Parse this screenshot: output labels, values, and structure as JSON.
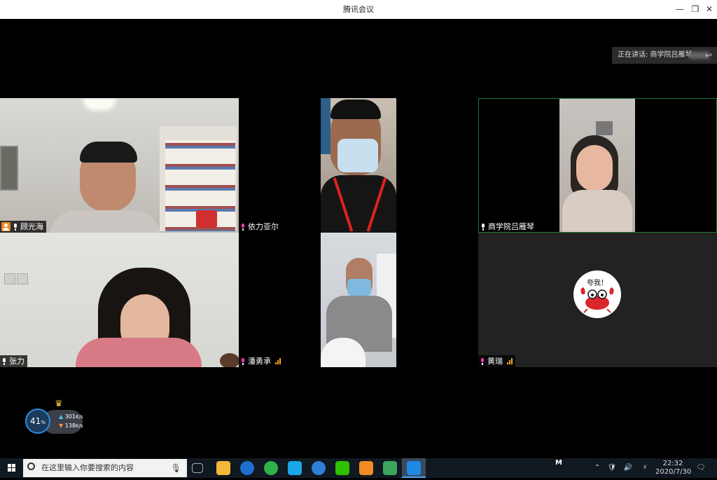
{
  "window": {
    "title": "腾讯会议",
    "controls": [
      "—",
      "❐",
      "✕"
    ]
  },
  "speaking": {
    "label": "正在讲话: 商学院吕雁琴",
    "back_icon": "reply-icon"
  },
  "participants": [
    {
      "name": "顾光海",
      "host": true,
      "muted": false
    },
    {
      "name": "依力亚尔",
      "muted": true
    },
    {
      "name": "商学院吕雁琴",
      "muted": false
    },
    {
      "name": "张力",
      "muted": false
    },
    {
      "name": "潘勇承",
      "muted": true,
      "signal": true
    },
    {
      "name": "黄瑞",
      "muted": true,
      "signal": true,
      "avatar_text": "夸我！"
    }
  ],
  "network": {
    "percent": "41",
    "percent_unit": "%",
    "up": "301",
    "up_unit": "K/s",
    "down": "138",
    "down_unit": "K/s"
  },
  "taskbar": {
    "search_placeholder": "在这里输入你要搜索的内容",
    "time": "22:32",
    "date": "2020/7/30",
    "tray_letter": "M"
  },
  "colors": {
    "accent": "#1e88e5",
    "signal": "#f5a623",
    "host": "#f08a24",
    "active_border": "#1f7a3a"
  }
}
